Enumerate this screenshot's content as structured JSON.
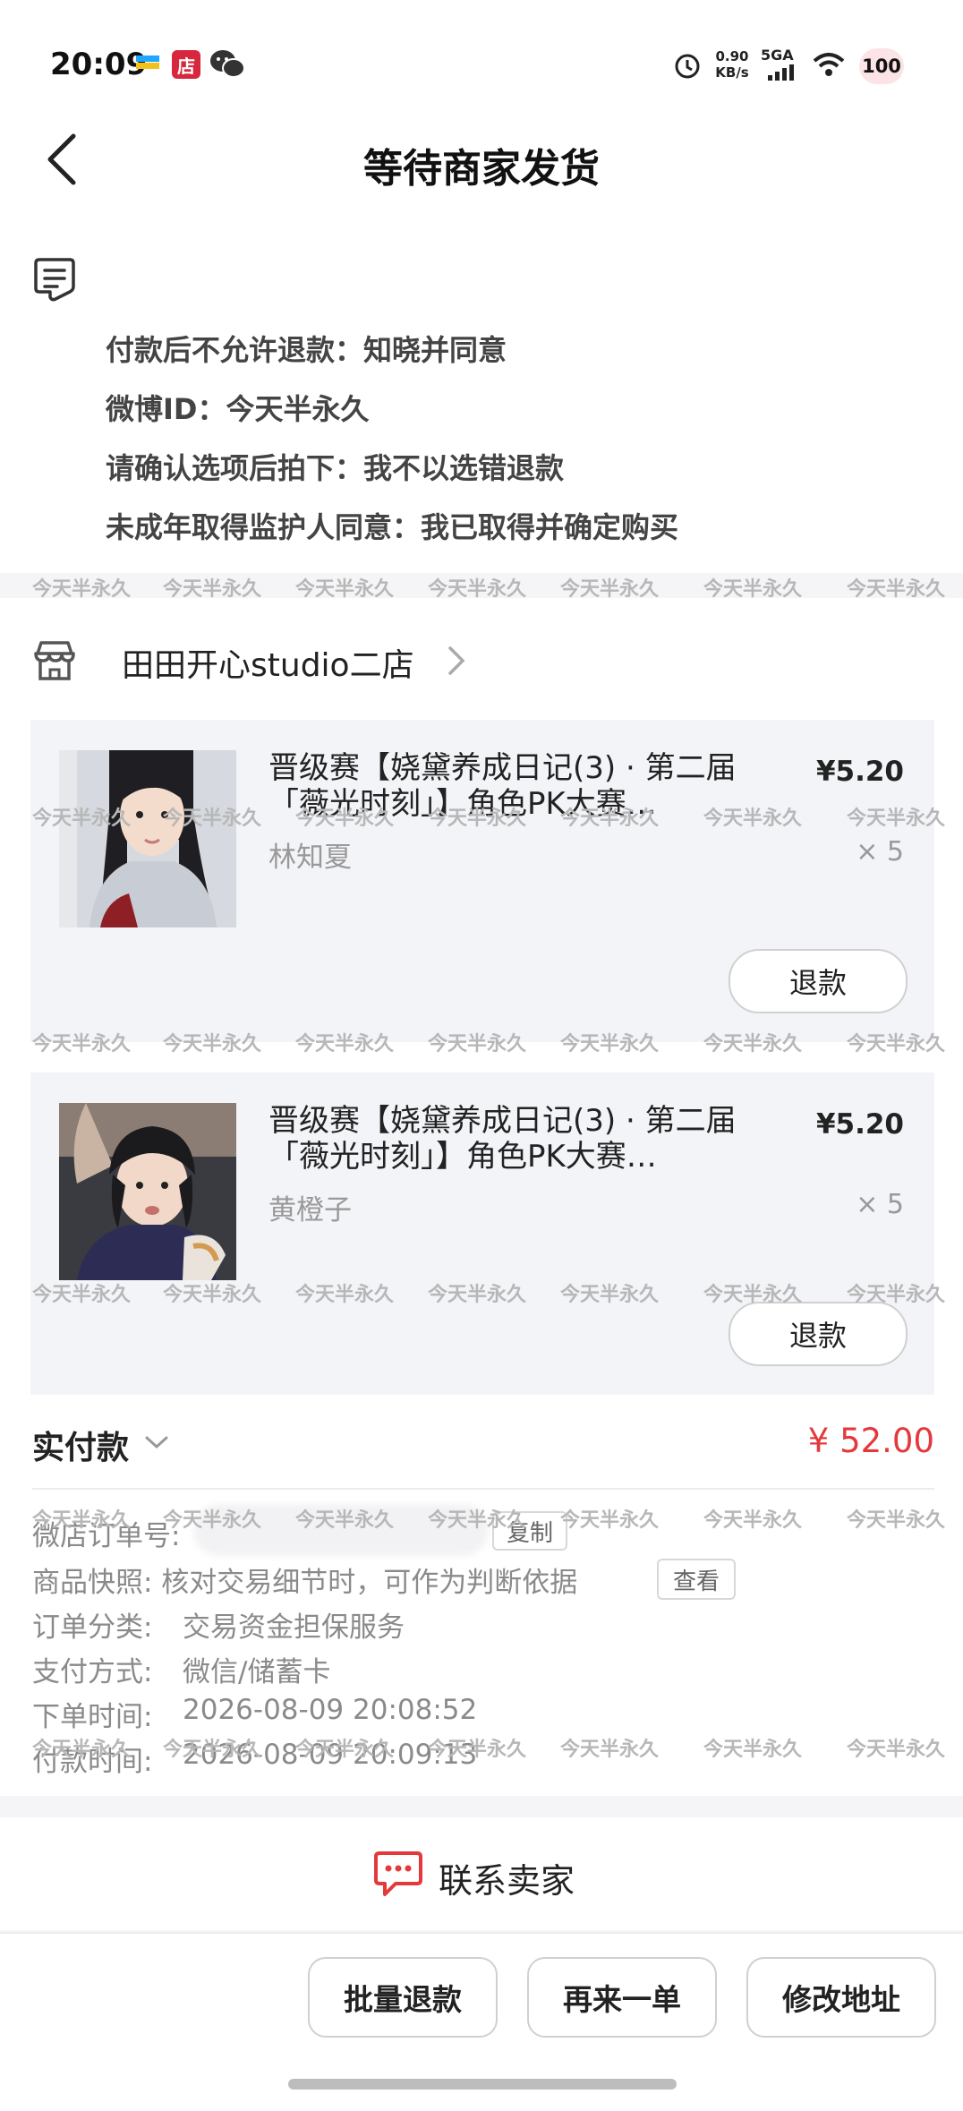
{
  "status_bar": {
    "time": "20:09",
    "app_badge": "店",
    "network_speed_top": "0.90",
    "network_speed_bottom": "KB/s",
    "network_type": "5GA",
    "battery": "100"
  },
  "header": {
    "title": "等待商家发货"
  },
  "notes": [
    "付款后不允许退款：知晓并同意",
    "微博ID：今天半永久",
    "请确认选项后拍下：我不以选错退款",
    "未成年取得监护人同意：我已取得并确定购买"
  ],
  "watermark": "今天半永久",
  "shop": {
    "name": "田田开心studio二店"
  },
  "items": [
    {
      "title": "晋级赛【娆黛养成日记(3) · 第二届「薇光时刻」】角色PK大赛…",
      "variant": "林知夏",
      "price": "¥5.20",
      "qty": "× 5",
      "refund_label": "退款"
    },
    {
      "title": "晋级赛【娆黛养成日记(3) · 第二届「薇光时刻」】角色PK大赛…",
      "variant": "黄橙子",
      "price": "¥5.20",
      "qty": "× 5",
      "refund_label": "退款"
    }
  ],
  "payment": {
    "label": "实付款",
    "amount": "¥ 52.00"
  },
  "order_info": {
    "order_no_label": "微店订单号:",
    "copy_label": "复制",
    "snapshot_text": "商品快照: 核对交易细节时，可作为判断依据",
    "view_label": "查看",
    "category_label": "订单分类:",
    "category_value": "交易资金担保服务",
    "pay_method_label": "支付方式:",
    "pay_method_value": "微信/储蓄卡",
    "order_time_label": "下单时间:",
    "order_time_value": "2026-08-09 20:08:52",
    "pay_time_label": "付款时间:",
    "pay_time_value": "2026-08-09 20:09:13"
  },
  "contact": {
    "label": "联系卖家"
  },
  "bottom_actions": {
    "batch_refund": "批量退款",
    "reorder": "再来一单",
    "edit_address": "修改地址"
  },
  "colors": {
    "accent_red": "#e4393c",
    "card_bg": "#f3f4f8",
    "page_bg": "#f5f5f7"
  }
}
